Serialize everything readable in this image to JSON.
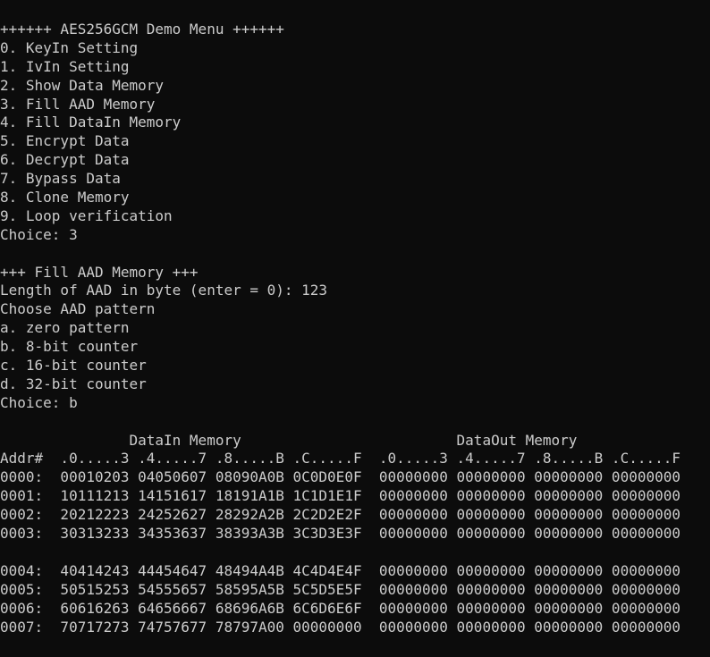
{
  "menu": {
    "title": "++++++ AES256GCM Demo Menu ++++++",
    "items": [
      "0. KeyIn Setting",
      "1. IvIn Setting",
      "2. Show Data Memory",
      "3. Fill AAD Memory",
      "4. Fill DataIn Memory",
      "5. Encrypt Data",
      "6. Decrypt Data",
      "7. Bypass Data",
      "8. Clone Memory",
      "9. Loop verification"
    ],
    "choice": "Choice: 3"
  },
  "aad": {
    "title": "+++ Fill AAD Memory +++",
    "length_prompt": "Length of AAD in byte (enter = 0): 123",
    "pattern_prompt": "Choose AAD pattern",
    "options": [
      "a. zero pattern",
      "b. 8-bit counter",
      "c. 16-bit counter",
      "d. 32-bit counter"
    ],
    "choice": "Choice: b"
  },
  "memory": {
    "titles_line": "               DataIn Memory                         DataOut Memory",
    "header_line": "Addr#  .0.....3 .4.....7 .8.....B .C.....F  .0.....3 .4.....7 .8.....B .C.....F",
    "block1": [
      "0000:  00010203 04050607 08090A0B 0C0D0E0F  00000000 00000000 00000000 00000000",
      "0001:  10111213 14151617 18191A1B 1C1D1E1F  00000000 00000000 00000000 00000000",
      "0002:  20212223 24252627 28292A2B 2C2D2E2F  00000000 00000000 00000000 00000000",
      "0003:  30313233 34353637 38393A3B 3C3D3E3F  00000000 00000000 00000000 00000000"
    ],
    "block2": [
      "0004:  40414243 44454647 48494A4B 4C4D4E4F  00000000 00000000 00000000 00000000",
      "0005:  50515253 54555657 58595A5B 5C5D5E5F  00000000 00000000 00000000 00000000",
      "0006:  60616263 64656667 68696A6B 6C6D6E6F  00000000 00000000 00000000 00000000",
      "0007:  70717273 74757677 78797A00 00000000  00000000 00000000 00000000 00000000"
    ]
  },
  "colors": {
    "background": "#0c0c0c",
    "foreground": "#cccccc"
  }
}
